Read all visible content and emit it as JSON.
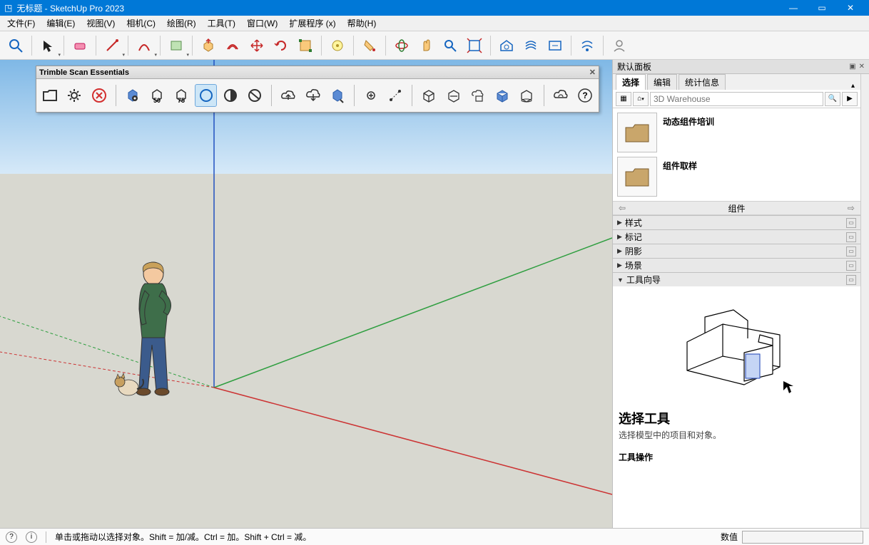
{
  "window": {
    "title": "无标题 - SketchUp Pro 2023"
  },
  "menu": [
    "文件(F)",
    "编辑(E)",
    "视图(V)",
    "相机(C)",
    "绘图(R)",
    "工具(T)",
    "窗口(W)",
    "扩展程序 (x)",
    "帮助(H)"
  ],
  "float_toolbar": {
    "title": "Trimble Scan Essentials"
  },
  "side": {
    "panel_title": "默认面板",
    "tabs": [
      "选择",
      "编辑",
      "统计信息"
    ],
    "search_placeholder": "3D Warehouse",
    "components": [
      {
        "name": "动态组件培训"
      },
      {
        "name": "组件取样"
      }
    ],
    "nav_label": "组件",
    "accordions": [
      "样式",
      "标记",
      "阴影",
      "场景",
      "工具向导"
    ],
    "instructor": {
      "title": "选择工具",
      "desc": "选择模型中的项目和对象。",
      "sub": "工具操作"
    }
  },
  "status": {
    "hint": "单击或拖动以选择对象。Shift = 加/减。Ctrl = 加。Shift + Ctrl = 减。",
    "measure_label": "数值"
  },
  "colors": {
    "titlebar": "#0078d7",
    "axis_red": "#cc3333",
    "axis_green": "#2e9e3f",
    "axis_blue": "#2050c0"
  }
}
